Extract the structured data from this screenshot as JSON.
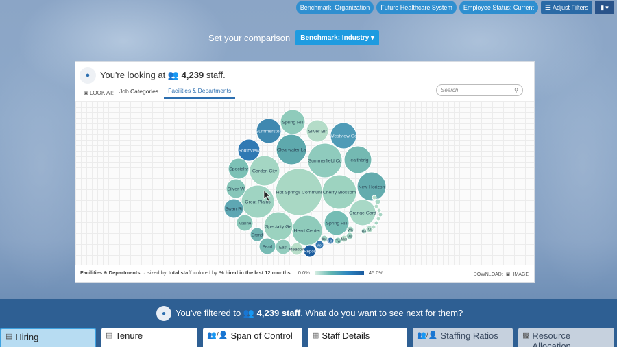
{
  "top_bar": {
    "benchmark_org": "Benchmark: Organization",
    "system": "Future Healthcare System",
    "employee_status": "Employee Status: Current",
    "adjust_filters": "Adjust Filters"
  },
  "compare": {
    "label": "Set your comparison",
    "button": "Benchmark: Industry ▾"
  },
  "panel": {
    "looking_prefix": "You're looking at ",
    "staff_count": "4,239",
    "looking_suffix": " staff.",
    "look_at": "LOOK AT:",
    "tabs": [
      "Job Categories",
      "Facilities & Departments"
    ],
    "search_placeholder": "Search",
    "footer": {
      "label": "Facilities & Departments",
      "sized_by": "sized by",
      "size_metric": "total staff",
      "colored_by": "colored by",
      "color_metric": "% hired in the last 12 months",
      "min": "0.0%",
      "max": "45.0%",
      "download": "DOWNLOAD:",
      "image": "IMAGE"
    }
  },
  "bubbles": [
    {
      "label": "Hot Springs Communi",
      "color": "#a9d8c4"
    },
    {
      "label": "Cherry Blossom",
      "color": "#9dd3c0"
    },
    {
      "label": "Summerfield Co",
      "color": "#8fcbbd"
    },
    {
      "label": "Great Plains",
      "color": "#9fd4c2"
    },
    {
      "label": "Garden City",
      "color": "#a4d6c3"
    },
    {
      "label": "Clearwater La",
      "color": "#5ea9ad"
    },
    {
      "label": "Heart Center",
      "color": "#8fcbbb"
    },
    {
      "label": "Specialty Ge",
      "color": "#9bd2bf"
    },
    {
      "label": "Healthbrig",
      "color": "#74b9b2"
    },
    {
      "label": "New Horizon",
      "color": "#64acae"
    },
    {
      "label": "Westview Ge",
      "color": "#4f9bb7"
    },
    {
      "label": "Summerston",
      "color": "#3f88b0"
    },
    {
      "label": "Spring Hill",
      "color": "#8fcbbb"
    },
    {
      "label": "Spring Hill",
      "color": "#75bcb4"
    },
    {
      "label": "Silver Bir",
      "color": "#b4dcc8"
    },
    {
      "label": "Southview",
      "color": "#2f79b3"
    },
    {
      "label": "Specialty",
      "color": "#7cc1b6"
    },
    {
      "label": "Orange Gard",
      "color": "#a8d8c6"
    },
    {
      "label": "Silver W",
      "color": "#86c6b9"
    },
    {
      "label": "Swan Ri",
      "color": "#5ea7b3"
    },
    {
      "label": "Marine",
      "color": "#8ac8b9"
    },
    {
      "label": "Grand",
      "color": "#6fb4b2"
    },
    {
      "label": "Pearl",
      "color": "#77bbb4"
    },
    {
      "label": "East",
      "color": "#92ccbd"
    },
    {
      "label": "Meadow",
      "color": "#b8dec9"
    },
    {
      "label": "Repos",
      "color": "#1b5c9e"
    },
    {
      "label": "Mor",
      "color": "#3577b0"
    },
    {
      "label": "Arc",
      "color": "#9fd0c0"
    },
    {
      "label": "Lib",
      "color": "#2e6fa9"
    },
    {
      "label": "Tw",
      "color": "#8fcbbb"
    },
    {
      "label": "Mar",
      "color": "#b8dec9"
    },
    {
      "label": "Wh",
      "color": "#a7d6c4"
    },
    {
      "label": "Mo",
      "color": "#9ed2c0"
    },
    {
      "label": "Ro",
      "color": "#a7d6c4"
    },
    {
      "label": "Cl",
      "color": "#b2dbc8"
    },
    {
      "label": "",
      "color": "#a9d8c5"
    },
    {
      "label": "",
      "color": "#b4dcc8"
    },
    {
      "label": "",
      "color": "#b4dcc8"
    },
    {
      "label": "",
      "color": "#a6d4c3"
    },
    {
      "label": "",
      "color": "#b4dcc8"
    },
    {
      "label": "",
      "color": "#a6d4c3"
    },
    {
      "label": "",
      "color": "#b4dcc8"
    },
    {
      "label": "",
      "color": "#b4dcc8"
    }
  ],
  "filtered": {
    "prefix": "You've filtered to ",
    "count": "4,239 staff",
    "suffix": ". What do you want to see next for them?"
  },
  "cards": [
    "Hiring",
    "Tenure",
    "Span of Control",
    "Staff Details",
    "Staffing Ratios",
    "Resource Allocation"
  ]
}
